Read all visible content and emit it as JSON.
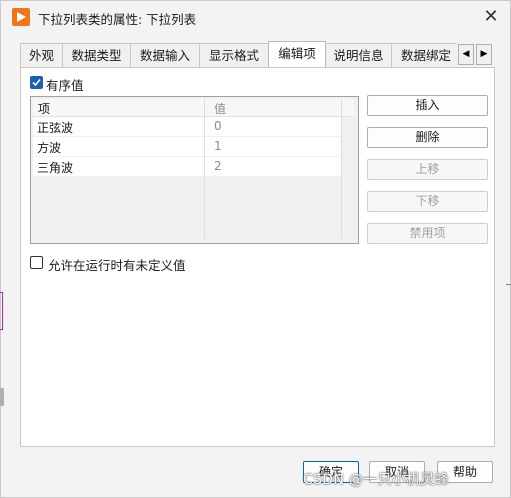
{
  "window": {
    "title": "下拉列表类的属性: 下拉列表",
    "close_glyph": "✕"
  },
  "tabs": [
    {
      "label": "外观"
    },
    {
      "label": "数据类型"
    },
    {
      "label": "数据输入"
    },
    {
      "label": "显示格式"
    },
    {
      "label": "编辑项",
      "active": true
    },
    {
      "label": "说明信息"
    },
    {
      "label": "数据绑定"
    }
  ],
  "tab_scroll": {
    "left": "◀",
    "right": "▶"
  },
  "ordered_checkbox": {
    "label": "有序值",
    "checked": true
  },
  "table": {
    "headers": [
      "项",
      "值"
    ],
    "rows": [
      {
        "item": "正弦波",
        "value": "0"
      },
      {
        "item": "方波",
        "value": "1"
      },
      {
        "item": "三角波",
        "value": "2"
      }
    ]
  },
  "side_buttons": {
    "insert": "插入",
    "delete": "删除",
    "move_up": "上移",
    "move_down": "下移",
    "disable": "禁用项"
  },
  "undefined_checkbox": {
    "label": "允许在运行时有未定义值",
    "checked": false
  },
  "bottom_buttons": {
    "ok": "确定",
    "cancel": "取消",
    "help": "帮助"
  },
  "watermark": "CSDN @一只小机灵蜂",
  "colors": {
    "accent": "#1a5fb4",
    "app_icon": "#f0761a"
  }
}
